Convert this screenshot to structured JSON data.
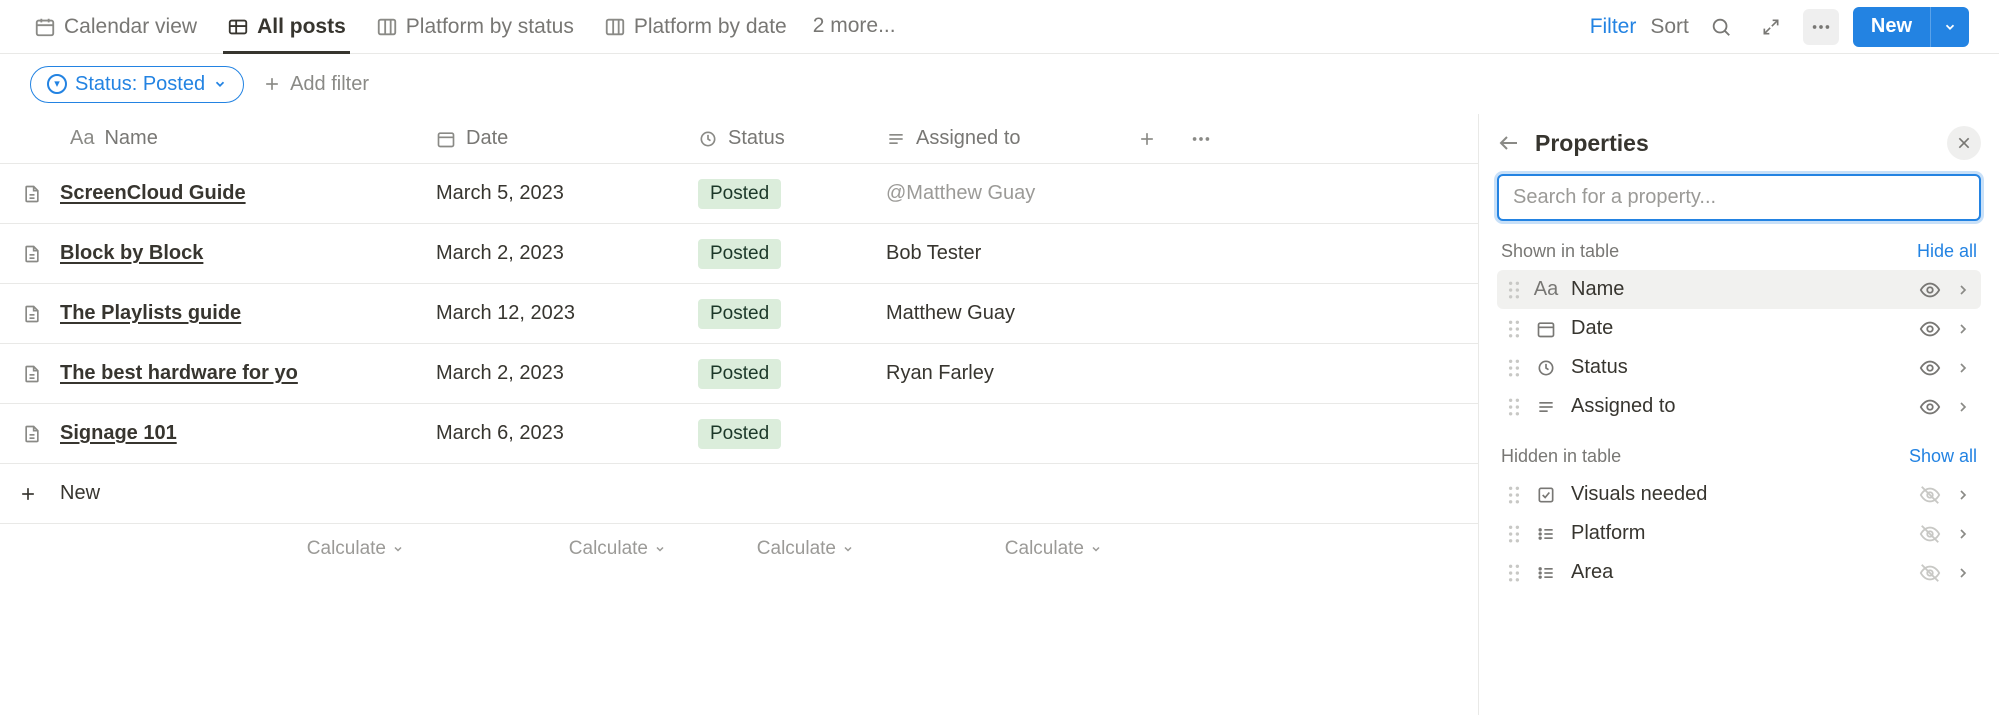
{
  "tabs": {
    "items": [
      {
        "label": "Calendar view"
      },
      {
        "label": "All posts"
      },
      {
        "label": "Platform by status"
      },
      {
        "label": "Platform by date"
      }
    ],
    "more": "2 more..."
  },
  "toolbar": {
    "filter": "Filter",
    "sort": "Sort",
    "new": "New"
  },
  "filters": {
    "status_chip": "Status: Posted",
    "add_filter": "Add filter"
  },
  "columns": {
    "name": "Name",
    "date": "Date",
    "status": "Status",
    "assigned": "Assigned to"
  },
  "rows": [
    {
      "name": "ScreenCloud Guide",
      "date": "March 5, 2023",
      "status": "Posted",
      "assigned": "@Matthew Guay",
      "assigned_gray": true
    },
    {
      "name": "Block by Block",
      "date": "March 2, 2023",
      "status": "Posted",
      "assigned": "Bob Tester",
      "assigned_gray": false
    },
    {
      "name": "The Playlists guide",
      "date": "March 12, 2023",
      "status": "Posted",
      "assigned": "Matthew Guay",
      "assigned_gray": false
    },
    {
      "name": "The best hardware for yo",
      "date": "March 2, 2023",
      "status": "Posted",
      "assigned": "Ryan Farley",
      "assigned_gray": false
    },
    {
      "name": "Signage 101",
      "date": "March 6, 2023",
      "status": "Posted",
      "assigned": "",
      "assigned_gray": false
    }
  ],
  "new_row": "New",
  "calculate": "Calculate",
  "panel": {
    "title": "Properties",
    "search_placeholder": "Search for a property...",
    "shown_header": "Shown in table",
    "hide_all": "Hide all",
    "hidden_header": "Hidden in table",
    "show_all": "Show all",
    "shown": [
      {
        "label": "Name",
        "icon": "text"
      },
      {
        "label": "Date",
        "icon": "calendar"
      },
      {
        "label": "Status",
        "icon": "status"
      },
      {
        "label": "Assigned to",
        "icon": "list"
      }
    ],
    "hidden": [
      {
        "label": "Visuals needed",
        "icon": "checkbox"
      },
      {
        "label": "Platform",
        "icon": "bullets"
      },
      {
        "label": "Area",
        "icon": "bullets"
      }
    ]
  }
}
